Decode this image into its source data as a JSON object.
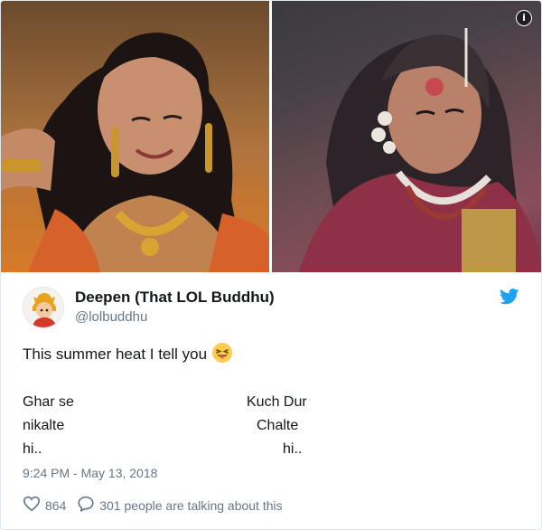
{
  "tweet": {
    "author": {
      "display_name": "Deepen (That LOL Buddhu)",
      "handle": "@lolbuddhu"
    },
    "text": "This summer heat I tell you",
    "emoji": "squinting-face-with-tongue",
    "verse": {
      "left_lines": [
        "Ghar se",
        "nikalte",
        "hi.."
      ],
      "right_lines": [
        "Kuch Dur",
        "Chalte",
        "hi.."
      ]
    },
    "timestamp": "9:24 PM - May 13, 2018",
    "likes": "864",
    "replies_text": "301 people are talking about this"
  },
  "icons": {
    "info": "i",
    "brand": "twitter-bird-icon"
  },
  "colors": {
    "twitter_blue": "#1da1f2",
    "secondary_text": "#657786",
    "border": "#e1e8ed"
  }
}
